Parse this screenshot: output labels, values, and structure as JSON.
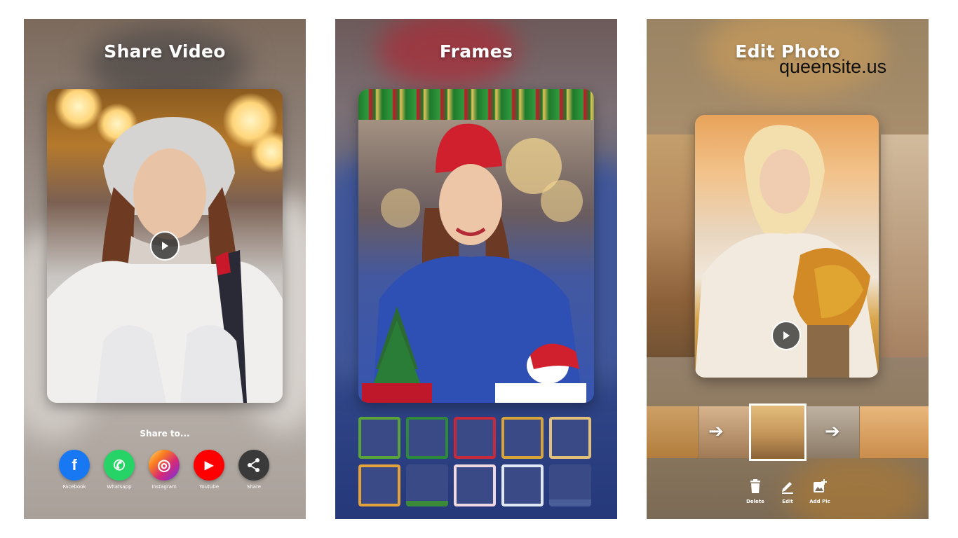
{
  "panels": [
    {
      "title": "Share Video",
      "share": {
        "heading": "Share to...",
        "items": [
          {
            "label": "Facebook",
            "icon": "facebook-icon",
            "glyph": "f",
            "color": "#1877f2"
          },
          {
            "label": "Whatsapp",
            "icon": "whatsapp-icon",
            "glyph": "✆",
            "color": "#25d366"
          },
          {
            "label": "Instagram",
            "icon": "instagram-icon",
            "glyph": "◎",
            "color": "#d6249f"
          },
          {
            "label": "Youtube",
            "icon": "youtube-icon",
            "glyph": "▶",
            "color": "#ff0000"
          },
          {
            "label": "Share",
            "icon": "share-icon",
            "glyph": "⋖",
            "color": "#3a3a3a"
          }
        ]
      }
    },
    {
      "title": "Frames"
    },
    {
      "title": "Edit Photo",
      "tools": [
        {
          "label": "Delete",
          "icon": "trash-icon"
        },
        {
          "label": "Edit",
          "icon": "pencil-icon"
        },
        {
          "label": "Add Pic",
          "icon": "add-photo-icon"
        }
      ]
    }
  ],
  "watermark": "queensite.us"
}
